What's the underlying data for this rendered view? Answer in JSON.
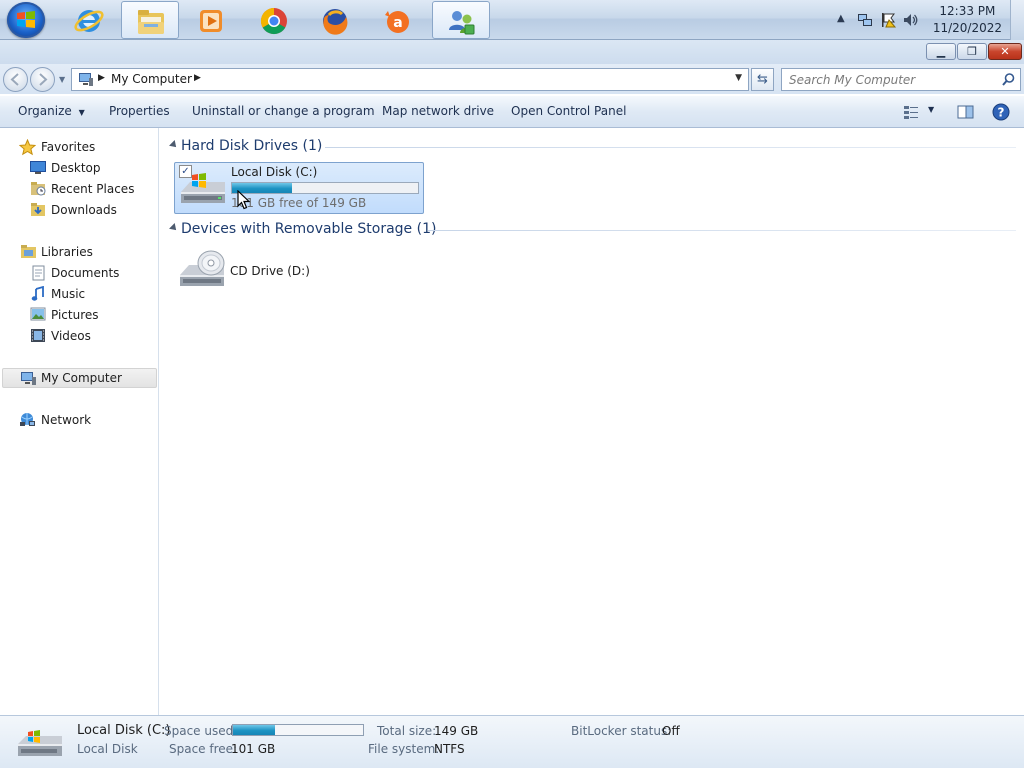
{
  "taskbar": {
    "apps": [
      {
        "name": "internet-explorer",
        "active": false
      },
      {
        "name": "windows-explorer",
        "active": true
      },
      {
        "name": "media-player",
        "active": false
      },
      {
        "name": "chrome",
        "active": false
      },
      {
        "name": "firefox",
        "active": false
      },
      {
        "name": "avast",
        "active": false
      },
      {
        "name": "user-accounts",
        "active": true
      }
    ],
    "clock": {
      "time": "12:33 PM",
      "date": "11/20/2022"
    }
  },
  "address": {
    "crumbs": [
      "My Computer"
    ],
    "search_placeholder": "Search My Computer"
  },
  "commands": {
    "organize": "Organize",
    "properties": "Properties",
    "uninstall": "Uninstall or change a program",
    "map_drive": "Map network drive",
    "control_panel": "Open Control Panel"
  },
  "nav": {
    "favorites": "Favorites",
    "desktop": "Desktop",
    "recent_places": "Recent Places",
    "downloads": "Downloads",
    "libraries": "Libraries",
    "documents": "Documents",
    "music": "Music",
    "pictures": "Pictures",
    "videos": "Videos",
    "my_computer": "My Computer",
    "network": "Network"
  },
  "groups": {
    "hdd": {
      "title": "Hard Disk Drives (1)",
      "drive": {
        "name": "Local Disk (C:)",
        "free_text": "101 GB free of 149 GB",
        "used_fraction": 0.32,
        "checked": true
      }
    },
    "removable": {
      "title": "Devices with Removable Storage (1)",
      "drive": {
        "name": "CD Drive (D:)"
      }
    }
  },
  "details": {
    "name": "Local Disk (C:)",
    "type": "Local Disk",
    "space_used_label": "Space used:",
    "space_used_fraction": 0.32,
    "space_free_label": "Space free:",
    "space_free": "101 GB",
    "total_size_label": "Total size:",
    "total_size": "149 GB",
    "file_system_label": "File system:",
    "file_system": "NTFS",
    "bitlocker_label": "BitLocker status:",
    "bitlocker": "Off"
  },
  "colors": {
    "accent": "#1d93c3",
    "selection": "#c1dcfc",
    "group_title": "#1e3c6e"
  }
}
